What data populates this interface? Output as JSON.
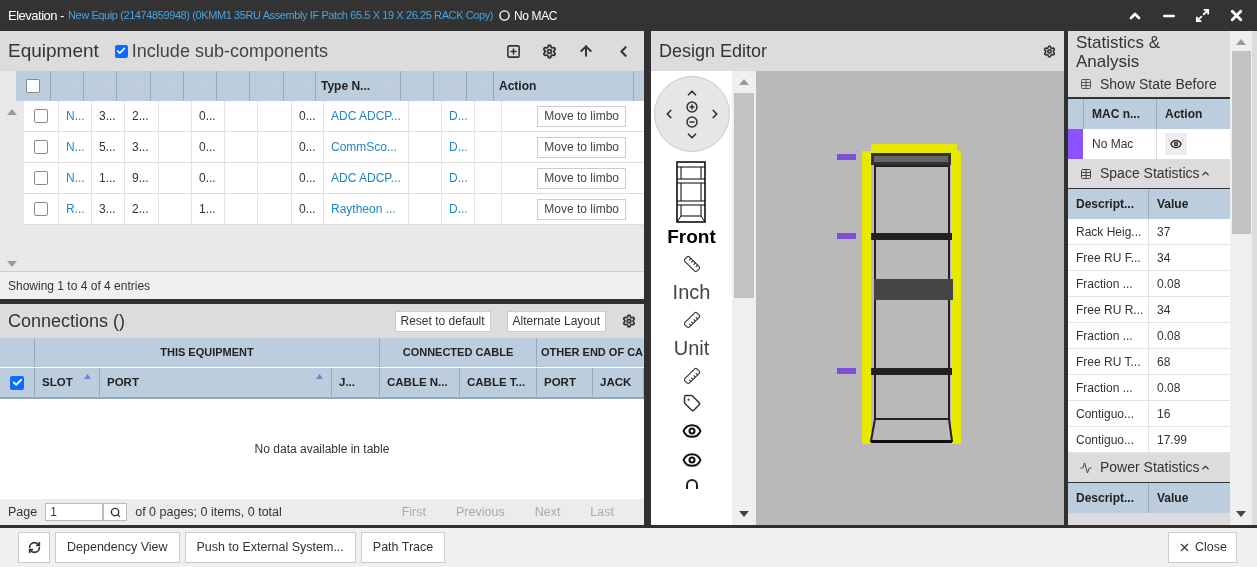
{
  "window": {
    "title": "Elevation -",
    "subtitle": "New Equip (21474859948) (0KMM1 35RU Assembly IF Patch 65.5 X 19 X 26.25 RACK Copy)",
    "mac": "No MAC"
  },
  "equipment": {
    "title": "Equipment",
    "include_sub_components": {
      "label": "Include sub-components",
      "checked": true
    },
    "select_all": {
      "checked": false
    },
    "columns": [
      {},
      {},
      {},
      {},
      {},
      {},
      {},
      {},
      {
        "label": "Type N..."
      },
      {},
      {},
      {},
      {
        "label": "Action"
      }
    ],
    "rows": [
      {
        "checked": false,
        "cells": [
          {
            "text": "N...",
            "kind": "link"
          },
          {
            "text": "3...",
            "kind": "text"
          },
          {
            "text": "2...",
            "kind": "text"
          },
          null,
          {
            "text": "0...",
            "kind": "text"
          },
          null,
          null,
          {
            "text": "0...",
            "kind": "text"
          },
          {
            "text": "ADC ADCP...",
            "kind": "link"
          },
          null,
          {
            "text": "D...",
            "kind": "link"
          },
          null
        ],
        "action": "Move to limbo"
      },
      {
        "checked": false,
        "cells": [
          {
            "text": "N...",
            "kind": "link"
          },
          {
            "text": "5...",
            "kind": "text"
          },
          {
            "text": "3...",
            "kind": "text"
          },
          null,
          {
            "text": "0...",
            "kind": "text"
          },
          null,
          null,
          {
            "text": "0...",
            "kind": "text"
          },
          {
            "text": "CommSco...",
            "kind": "link"
          },
          null,
          {
            "text": "D...",
            "kind": "link"
          },
          null
        ],
        "action": "Move to limbo"
      },
      {
        "checked": false,
        "cells": [
          {
            "text": "N...",
            "kind": "link"
          },
          {
            "text": "1...",
            "kind": "text"
          },
          {
            "text": "9...",
            "kind": "text"
          },
          null,
          {
            "text": "0...",
            "kind": "text"
          },
          null,
          null,
          {
            "text": "0...",
            "kind": "text"
          },
          {
            "text": "ADC ADCP...",
            "kind": "link"
          },
          null,
          {
            "text": "D...",
            "kind": "link"
          },
          null
        ],
        "action": "Move to limbo"
      },
      {
        "checked": false,
        "cells": [
          {
            "text": "R...",
            "kind": "link"
          },
          {
            "text": "3...",
            "kind": "text"
          },
          {
            "text": "2...",
            "kind": "text"
          },
          null,
          {
            "text": "1...",
            "kind": "text"
          },
          null,
          null,
          {
            "text": "0...",
            "kind": "text"
          },
          {
            "text": "Raytheon ...",
            "kind": "link"
          },
          null,
          {
            "text": "D...",
            "kind": "link"
          },
          null
        ],
        "action": "Move to limbo"
      }
    ],
    "footer": "Showing 1 to 4 of 4 entries"
  },
  "connections": {
    "title": "Connections ()",
    "buttons": [
      "Reset to default",
      "Alternate Layout"
    ],
    "select_all": {
      "checked": true
    },
    "groups": [
      {
        "label": "THIS EQUIPMENT"
      },
      {
        "label": "CONNECTED CABLE"
      },
      {
        "label": "OTHER END OF CA"
      }
    ],
    "columns": [
      {
        "label": "SLOT",
        "sorted": true
      },
      {
        "label": "PORT",
        "sorted": true
      },
      {
        "label": "J...",
        "sorted": false
      },
      {
        "label": "CABLE N..."
      },
      {
        "label": "CABLE T..."
      },
      {
        "label": "PORT"
      },
      {
        "label": "JACK"
      }
    ],
    "empty": "No data available in table",
    "pager": {
      "label": "Page",
      "value": "1",
      "summary": "of 0 pages; 0 items, 0 total",
      "links": [
        {
          "label": "First",
          "disabled": true
        },
        {
          "label": "Previous",
          "disabled": true
        },
        {
          "label": "Next",
          "disabled": true
        },
        {
          "label": "Last",
          "disabled": true
        }
      ]
    }
  },
  "design_editor": {
    "title": "Design Editor",
    "tools": [
      {
        "kind": "view",
        "label": "Front"
      },
      {
        "kind": "ruler"
      },
      {
        "kind": "label",
        "label": "Inch"
      },
      {
        "kind": "vruler"
      },
      {
        "kind": "label",
        "label": "Unit"
      },
      {
        "kind": "vruler"
      },
      {
        "kind": "tag"
      },
      {
        "kind": "eye"
      },
      {
        "kind": "eye"
      },
      {
        "kind": "arc"
      }
    ]
  },
  "statistics": {
    "title": "Statistics & Analysis",
    "show_state": "Show State Before",
    "mac_table": {
      "columns": [
        "MAC n...",
        "Action"
      ],
      "rows": [
        {
          "color": "#8c52ff",
          "name": "No Mac"
        }
      ]
    },
    "sections": [
      {
        "title": "Space Statistics",
        "expanded": true,
        "columns": [
          "Descript...",
          "Value"
        ],
        "rows": [
          [
            "Rack Heig...",
            "37"
          ],
          [
            "Free RU F...",
            "34"
          ],
          [
            "Fraction ...",
            "0.08"
          ],
          [
            "Free RU R...",
            "34"
          ],
          [
            "Fraction ...",
            "0.08"
          ],
          [
            "Free RU T...",
            "68"
          ],
          [
            "Fraction ...",
            "0.08"
          ],
          [
            "Contiguo...",
            "16"
          ],
          [
            "Contiguo...",
            "17.99"
          ]
        ]
      },
      {
        "title": "Power Statistics",
        "expanded": true,
        "columns": [
          "Descript...",
          "Value"
        ]
      }
    ]
  },
  "footer": {
    "buttons": [
      "Dependency View",
      "Push to External System...",
      "Path Trace"
    ],
    "close": "Close"
  }
}
